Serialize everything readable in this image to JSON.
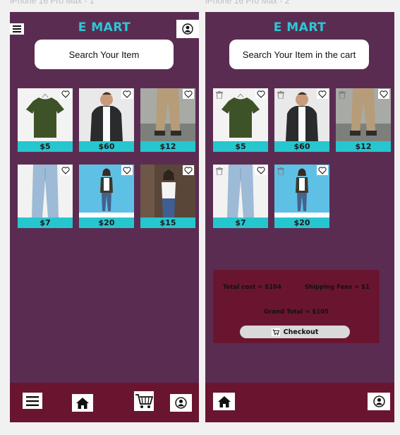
{
  "screens": [
    {
      "frame_title": "iPhone 16 Pro Max - 1",
      "brand": "E MART",
      "search_placeholder": "Search Your Item",
      "products": [
        {
          "price": "$5",
          "image": "green-tshirt"
        },
        {
          "price": "$60",
          "image": "man-black-jacket"
        },
        {
          "price": "$12",
          "image": "khaki-pants"
        },
        {
          "price": "$7",
          "image": "light-jeans"
        },
        {
          "price": "$20",
          "image": "woman-jacket-blue"
        },
        {
          "price": "$15",
          "image": "woman-white-top"
        }
      ]
    },
    {
      "frame_title": "iPhone 16 Pro Max - 2",
      "brand": "E MART",
      "search_placeholder": "Search Your Item in the cart",
      "cart_items": [
        {
          "price": "$5",
          "image": "green-tshirt"
        },
        {
          "price": "$60",
          "image": "man-black-jacket"
        },
        {
          "price": "$12",
          "image": "khaki-pants"
        },
        {
          "price": "$7",
          "image": "light-jeans"
        },
        {
          "price": "$20",
          "image": "woman-jacket-blue"
        }
      ],
      "summary": {
        "total_cost": "Total  cost = $104",
        "shipping_fees": "Shipping Fees = $1",
        "grand_total": "Grand Total = $105",
        "checkout_label": "Checkout"
      }
    }
  ],
  "colors": {
    "background": "#5b2c52",
    "accent": "#26c6cf",
    "bar": "#6a1530",
    "brand": "#2ec7d6"
  },
  "icons": [
    "menu-icon",
    "profile-icon",
    "heart-icon",
    "trash-icon",
    "home-icon",
    "cart-icon"
  ]
}
